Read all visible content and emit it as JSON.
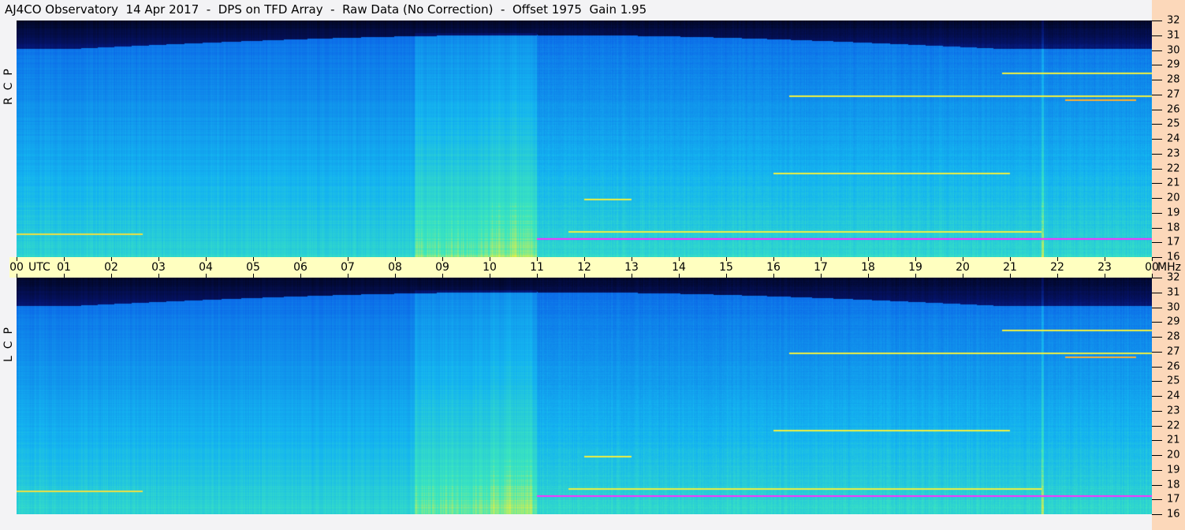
{
  "title": "AJ4CO Observatory  14 Apr 2017  -  DPS on TFD Array  -  Raw Data (No Correction)  -  Offset 1975  Gain 1.95",
  "chart_data": {
    "type": "heatmap",
    "title": "AJ4CO Observatory  14 Apr 2017  -  DPS on TFD Array  -  Raw Data (No Correction)  -  Offset 1975  Gain 1.95",
    "xlabel": "UTC",
    "ylabel": "MHz",
    "xlim": [
      0,
      24
    ],
    "ylim": [
      16,
      32
    ],
    "x_ticks": [
      "00",
      "01",
      "02",
      "03",
      "04",
      "05",
      "06",
      "07",
      "08",
      "09",
      "10",
      "11",
      "12",
      "13",
      "14",
      "15",
      "16",
      "17",
      "18",
      "19",
      "20",
      "21",
      "22",
      "23",
      "00"
    ],
    "y_ticks": [
      "32",
      "31",
      "30",
      "29",
      "28",
      "27",
      "26",
      "25",
      "24",
      "23",
      "22",
      "21",
      "20",
      "19",
      "18",
      "17",
      "16"
    ],
    "panels": [
      {
        "name": "RCP",
        "label": "R  C  P"
      },
      {
        "name": "LCP",
        "label": "L  C  P"
      }
    ],
    "colors": {
      "low": "#000000",
      "mid": "#0a5ce8",
      "high": "#3fe0c0",
      "peak": "#ff30ff"
    }
  }
}
